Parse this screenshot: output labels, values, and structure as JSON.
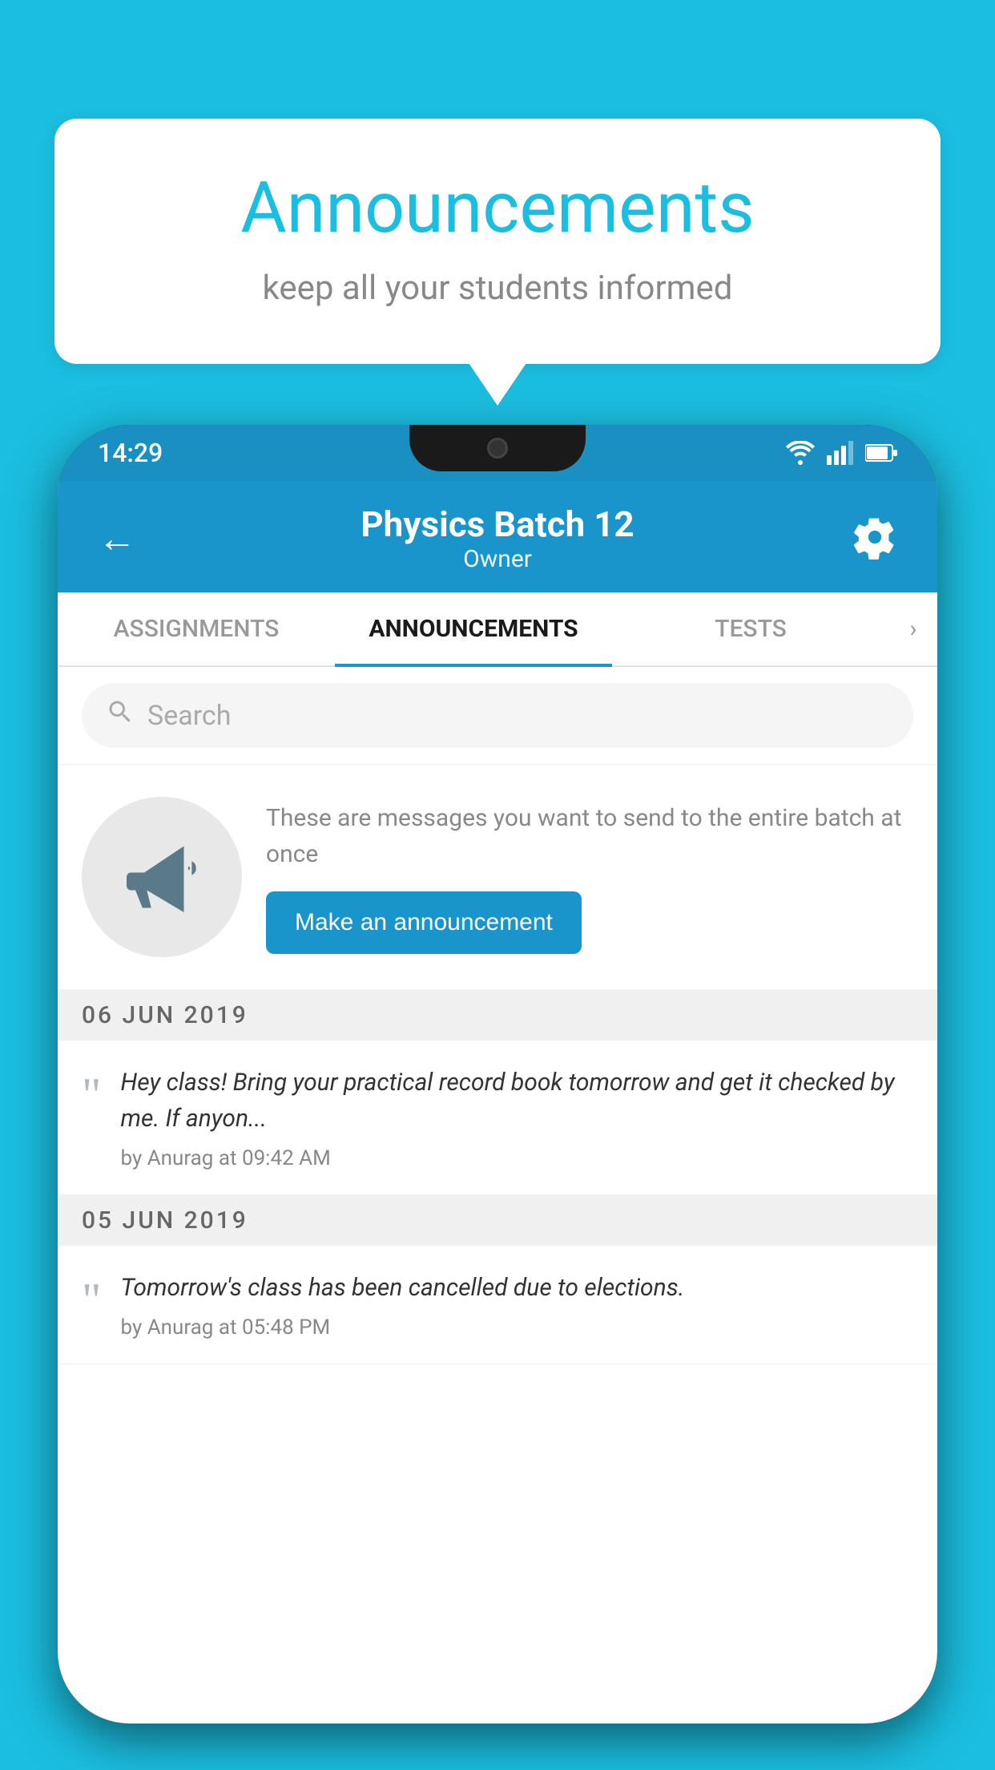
{
  "background_color": "#1bbee0",
  "speech_bubble": {
    "title": "Announcements",
    "subtitle": "keep all your students informed"
  },
  "status_bar": {
    "time": "14:29",
    "icons": [
      "wifi",
      "signal",
      "battery"
    ]
  },
  "app_header": {
    "title": "Physics Batch 12",
    "subtitle": "Owner",
    "back_label": "←"
  },
  "tabs": [
    {
      "label": "ASSIGNMENTS",
      "active": false
    },
    {
      "label": "ANNOUNCEMENTS",
      "active": true
    },
    {
      "label": "TESTS",
      "active": false
    }
  ],
  "search": {
    "placeholder": "Search"
  },
  "promo": {
    "description": "These are messages you want to send to the entire batch at once",
    "button_label": "Make an announcement"
  },
  "announcement_sections": [
    {
      "date": "06  JUN  2019",
      "items": [
        {
          "text": "Hey class! Bring your practical record book tomorrow and get it checked by me. If anyon...",
          "author": "by Anurag at 09:42 AM"
        }
      ]
    },
    {
      "date": "05  JUN  2019",
      "items": [
        {
          "text": "Tomorrow's class has been cancelled due to elections.",
          "author": "by Anurag at 05:48 PM"
        }
      ]
    }
  ]
}
